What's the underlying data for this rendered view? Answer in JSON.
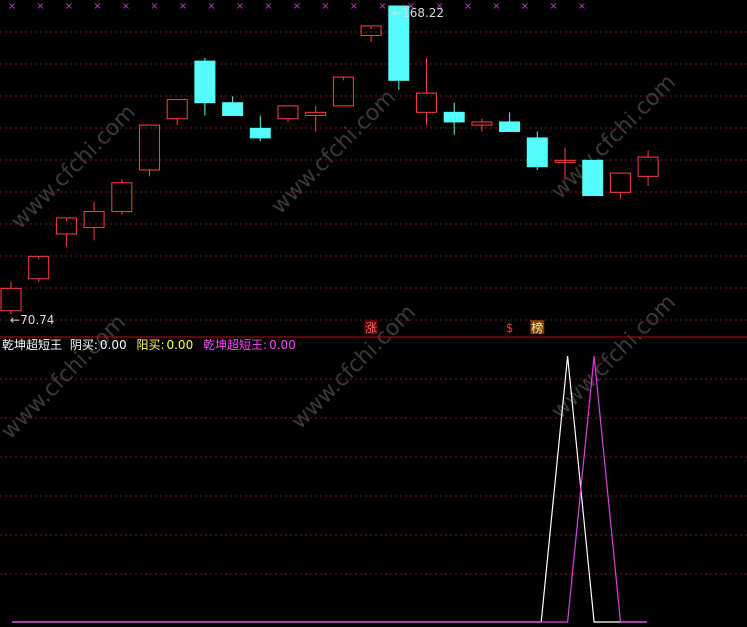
{
  "chart_data": [
    {
      "type": "candlestick",
      "y_high_label": "168.22",
      "y_low_label": "70.74",
      "ylim": [
        70.74,
        168.22
      ],
      "colors": {
        "up": "#ff4040",
        "down": "#54fcfc",
        "marker": "#cc33cc",
        "grid": "#7a1a1a"
      },
      "candles": [
        {
          "o": 73,
          "h": 82,
          "l": 72,
          "c": 80
        },
        {
          "o": 83,
          "h": 89,
          "l": 82,
          "c": 90
        },
        {
          "o": 97,
          "h": 101,
          "l": 93,
          "c": 102
        },
        {
          "o": 99,
          "h": 107,
          "l": 95,
          "c": 104
        },
        {
          "o": 104,
          "h": 114,
          "l": 103,
          "c": 113
        },
        {
          "o": 117,
          "h": 131,
          "l": 115,
          "c": 131
        },
        {
          "o": 133,
          "h": 139,
          "l": 131,
          "c": 139
        },
        {
          "o": 151,
          "h": 152,
          "l": 134,
          "c": 138
        },
        {
          "o": 138,
          "h": 140,
          "l": 134,
          "c": 134
        },
        {
          "o": 130,
          "h": 134,
          "l": 126,
          "c": 127
        },
        {
          "o": 133,
          "h": 137,
          "l": 132,
          "c": 137
        },
        {
          "o": 134,
          "h": 137,
          "l": 129,
          "c": 135
        },
        {
          "o": 137,
          "h": 145,
          "l": 137,
          "c": 146
        },
        {
          "o": 159,
          "h": 161,
          "l": 157,
          "c": 162
        },
        {
          "o": 168.22,
          "h": 168.22,
          "l": 142,
          "c": 145
        },
        {
          "o": 135,
          "h": 152,
          "l": 131,
          "c": 141
        },
        {
          "o": 135,
          "h": 138,
          "l": 128,
          "c": 132
        },
        {
          "o": 131,
          "h": 133,
          "l": 129,
          "c": 132
        },
        {
          "o": 132,
          "h": 135,
          "l": 129,
          "c": 129
        },
        {
          "o": 127,
          "h": 129,
          "l": 117,
          "c": 118
        },
        {
          "o": 120,
          "h": 124,
          "l": 114,
          "c": 120
        },
        {
          "o": 120,
          "h": 120,
          "l": 109,
          "c": 109
        },
        {
          "o": 110,
          "h": 116,
          "l": 108,
          "c": 116
        },
        {
          "o": 115,
          "h": 123,
          "l": 112,
          "c": 121
        }
      ],
      "top_markers": [
        "×",
        "×",
        "×",
        "×",
        "×",
        "×",
        "×",
        "×",
        "×",
        "×",
        "×",
        "×",
        "×",
        "×",
        "×",
        "×",
        "×",
        "×",
        "×",
        "×",
        "×"
      ],
      "signals": [
        {
          "index": 13,
          "text": "涨",
          "color": "#ff6666",
          "bg": "#5a0000"
        },
        {
          "index": 18,
          "text": "$",
          "color": "#ff3333",
          "bg": ""
        },
        {
          "index": 19,
          "text": "榜",
          "color": "#ffee88",
          "bg": "#7a3a10"
        }
      ]
    },
    {
      "type": "line",
      "indicator_name": "乾坤超短王",
      "legend": [
        {
          "label": "阴买:",
          "value": "0.00",
          "color": "#ffffff"
        },
        {
          "label": "阳买:",
          "value": "0.00",
          "color": "#ffff55"
        },
        {
          "label": "乾坤超短王:",
          "value": "0.00",
          "color": "#ff44ff"
        }
      ],
      "ylim": [
        0,
        1
      ],
      "series": [
        {
          "color": "#ffffff",
          "points": [
            [
              0,
              0
            ],
            [
              20,
              0
            ],
            [
              21,
              1
            ],
            [
              22,
              0
            ],
            [
              24,
              0
            ]
          ]
        },
        {
          "color": "#dd44dd",
          "points": [
            [
              0,
              0
            ],
            [
              21,
              0
            ],
            [
              22,
              1
            ],
            [
              23,
              0
            ],
            [
              24,
              0
            ]
          ]
        }
      ]
    }
  ],
  "watermark": "www.cfchi.com"
}
